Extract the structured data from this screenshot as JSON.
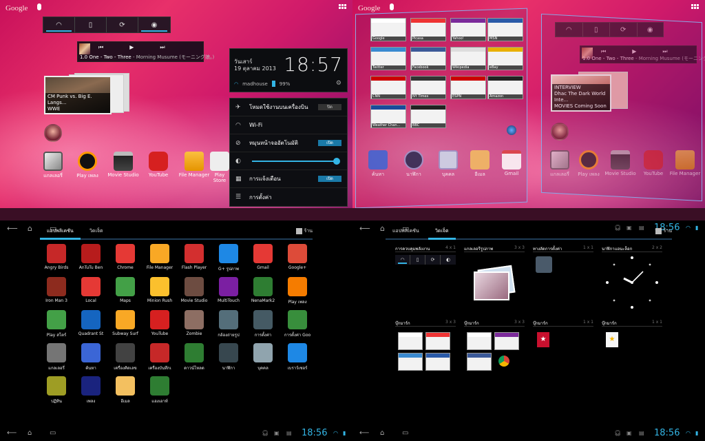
{
  "home": {
    "search_brand": "Google",
    "power_icons": [
      "wifi-icon",
      "bluetooth-icon",
      "sync-icon",
      "brightness-icon"
    ],
    "music": {
      "track": "1.0 One - Two - Three",
      "artist": "- Morning Musume (モーニング娘。)",
      "controls": [
        "⏮",
        "▶",
        "⏭"
      ]
    },
    "youtube": {
      "caption_line1": "CM Punk vs. Big E. Langs...",
      "caption_line2": "WWE"
    },
    "dock": [
      {
        "label": "แกลเลอรี่",
        "icon": "gallery-icon"
      },
      {
        "label": "Play เพลง",
        "icon": "play-music-icon"
      },
      {
        "label": "Movie Studio",
        "icon": "movie-studio-icon"
      },
      {
        "label": "YouTube",
        "icon": "youtube-icon"
      },
      {
        "label": "File Manager",
        "icon": "file-manager-icon"
      },
      {
        "label": "Play Store",
        "icon": "play-store-icon"
      }
    ]
  },
  "shade": {
    "day": "วันเสาร์",
    "date": "19 ตุลาคม 2013",
    "time": "18:57",
    "network": "madhouse",
    "battery": "99%",
    "rows": [
      {
        "label": "โหมดใช้งานบนเครื่องบิน",
        "icon": "airplane-icon",
        "toggle": "ปิด",
        "state": "off"
      },
      {
        "label": "Wi-Fi",
        "icon": "wifi-icon",
        "toggle": "",
        "state": ""
      },
      {
        "label": "หมุนหน้าจออัตโนมัติ",
        "icon": "rotate-icon",
        "toggle": "เปิด",
        "state": "on"
      },
      {
        "label": "",
        "icon": "brightness-icon",
        "toggle": "",
        "state": "slider"
      },
      {
        "label": "การแจ้งเตือน",
        "icon": "notification-icon",
        "toggle": "เปิด",
        "state": "on"
      },
      {
        "label": "การตั้งค่า",
        "icon": "settings-icon",
        "toggle": "",
        "state": ""
      }
    ]
  },
  "pages": {
    "thumbs": [
      {
        "label": "Google"
      },
      {
        "label": "Picasa"
      },
      {
        "label": "Yahoo!"
      },
      {
        "label": "MSN"
      },
      {
        "label": "Twitter"
      },
      {
        "label": "Facebook"
      },
      {
        "label": "Wikipedia"
      },
      {
        "label": "eBay"
      },
      {
        "label": "CNN"
      },
      {
        "label": "NY Times"
      },
      {
        "label": "ESPN"
      },
      {
        "label": "Amazon"
      },
      {
        "label": "Weather Chan..."
      },
      {
        "label": "BBC"
      }
    ],
    "dock": [
      {
        "label": "ค้นหา",
        "icon": "search-app-icon"
      },
      {
        "label": "นาฬิกา",
        "icon": "clock-icon"
      },
      {
        "label": "บุคคล",
        "icon": "people-icon"
      },
      {
        "label": "อีเมล",
        "icon": "email-icon"
      },
      {
        "label": "Gmail",
        "icon": "gmail-icon"
      }
    ],
    "interview_caption1": "INTERVIEW",
    "interview_caption2": "Dhac The Dark World Inte...",
    "interview_caption3": "MOVIES Coming Soon"
  },
  "drawer": {
    "tab_apps": "แอปพลิเคชัน",
    "tab_widgets": "วิดเจ็ต",
    "store": "ร้าน",
    "apps": [
      "Angry Birds",
      "AnTuTu Ben",
      "Chrome",
      "File Manager",
      "Flash Player",
      "G+ รูปภาพ",
      "Gmail",
      "Google+",
      "Iron Man 3",
      "Local",
      "Maps",
      "Minion Rush",
      "Movie Studio",
      "MultiTouch",
      "NenaMark2",
      "Play เพลง",
      "Play สโตร์",
      "Quadrant St",
      "Subway Surf",
      "YouTube",
      "Zombie",
      "กล้องถ่ายรูป",
      "การตั้งค่า",
      "การตั้งค่า Goo",
      "แกลเลอรี่",
      "ค้นหา",
      "เครื่องคิดเลข",
      "เครื่องบันทึกเ",
      "ดาวน์โหลด",
      "นาฬิกา",
      "บุคคล",
      "เบราว์เซอร์",
      "ปฏิทิน",
      "เพลง",
      "อีเมล",
      "แฮงเอาท์"
    ],
    "time": "18:56"
  },
  "widgets": {
    "tab_apps": "แอปพลิเคชัน",
    "tab_widgets": "วิดเจ็ต",
    "store": "ร้าน",
    "items": [
      {
        "label": "การควบคุมพลังงาน",
        "size": "4 x 1"
      },
      {
        "label": "แกลเลอรีรูปภาพ",
        "size": "3 x 3"
      },
      {
        "label": "ทางลัดการตั้งค่า",
        "size": "1 x 1"
      },
      {
        "label": "นาฬิกาแอนะล็อก",
        "size": "2 x 2"
      },
      {
        "label": "บุ๊กมาร์ก",
        "size": "3 x 3"
      },
      {
        "label": "บุ๊กมาร์ก",
        "size": "3 x 3"
      },
      {
        "label": "บุ๊กมาร์ก",
        "size": "1 x 1"
      },
      {
        "label": "บุ๊กมาร์ก",
        "size": "1 x 1"
      }
    ],
    "time": "18:56"
  },
  "colors": {
    "accent": "#33b5e5",
    "wallpaper": "#d01a6a"
  }
}
